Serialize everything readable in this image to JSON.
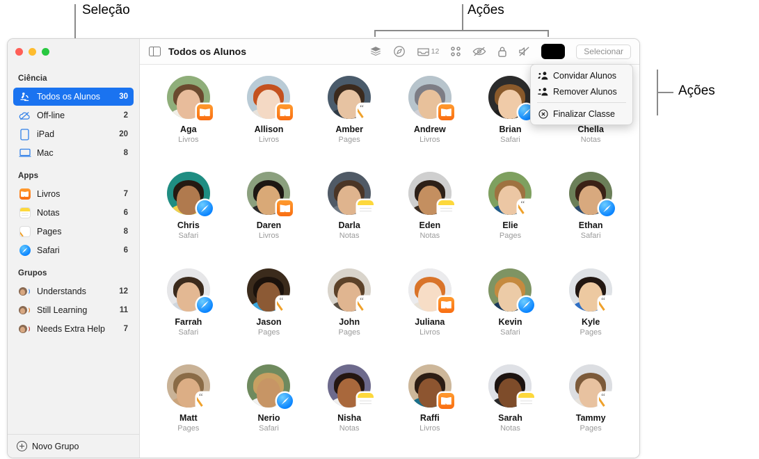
{
  "annotations": [
    {
      "id": "selecao",
      "text": "Seleção"
    },
    {
      "id": "acoes_top",
      "text": "Ações"
    },
    {
      "id": "acoes_right",
      "text": "Ações"
    }
  ],
  "window": {
    "traffic_lights": [
      "close",
      "minimize",
      "zoom"
    ]
  },
  "sidebar": {
    "sections": [
      {
        "header": "Ciência",
        "items": [
          {
            "label": "Todos os Alunos",
            "count": "30",
            "icon": "microscope-icon",
            "selected": true
          },
          {
            "label": "Off-line",
            "count": "2",
            "icon": "cloud-slash-icon",
            "selected": false
          },
          {
            "label": "iPad",
            "count": "20",
            "icon": "ipad-icon",
            "selected": false
          },
          {
            "label": "Mac",
            "count": "8",
            "icon": "mac-icon",
            "selected": false
          }
        ]
      },
      {
        "header": "Apps",
        "items": [
          {
            "label": "Livros",
            "count": "7",
            "icon": "books-app-icon",
            "selected": false
          },
          {
            "label": "Notas",
            "count": "6",
            "icon": "notes-app-icon",
            "selected": false
          },
          {
            "label": "Pages",
            "count": "8",
            "icon": "pages-app-icon",
            "selected": false
          },
          {
            "label": "Safari",
            "count": "6",
            "icon": "safari-app-icon",
            "selected": false
          }
        ]
      },
      {
        "header": "Grupos",
        "items": [
          {
            "label": "Understands",
            "count": "12",
            "icon": "group-blue-icon",
            "selected": false
          },
          {
            "label": "Still Learning",
            "count": "11",
            "icon": "group-orange-icon",
            "selected": false
          },
          {
            "label": "Needs Extra Help",
            "count": "7",
            "icon": "group-red-icon",
            "selected": false
          }
        ]
      }
    ],
    "footer": {
      "label": "Novo Grupo",
      "icon": "plus-circle-icon"
    }
  },
  "toolbar": {
    "sidebar_toggle_icon": "sidebar-toggle-icon",
    "title": "Todos os Alunos",
    "icons": [
      {
        "name": "layers-icon",
        "badge": ""
      },
      {
        "name": "navigate-icon",
        "badge": ""
      },
      {
        "name": "tray-icon",
        "badge": "12"
      },
      {
        "name": "grid-apps-icon",
        "badge": ""
      },
      {
        "name": "eye-slash-icon",
        "badge": ""
      },
      {
        "name": "lock-icon",
        "badge": ""
      },
      {
        "name": "mute-icon",
        "badge": ""
      }
    ],
    "screen_swatch_color": "#000000",
    "select_button": "Selecionar"
  },
  "menu": {
    "items": [
      {
        "label": "Convidar Alunos",
        "icon": "person-add-icon"
      },
      {
        "label": "Remover Alunos",
        "icon": "person-remove-icon"
      },
      {
        "label": "Finalizar Classe",
        "icon": "xmark-circle-icon"
      }
    ],
    "separator_after_index": 1
  },
  "students": [
    {
      "name": "Aga",
      "app": "Livros",
      "badge": "livros",
      "skin": "#e8bc9b",
      "hair": "#6b4a2f",
      "bg": "#8fae7a",
      "body": "#f2efe8"
    },
    {
      "name": "Allison",
      "app": "Livros",
      "badge": "livros",
      "skin": "#f4d9c4",
      "hair": "#c4521f",
      "bg": "#b9cbd6",
      "body": "#e8e3dc"
    },
    {
      "name": "Amber",
      "app": "Pages",
      "badge": "pages",
      "skin": "#e7c3a2",
      "hair": "#3b2a1d",
      "bg": "#4a5b6b",
      "body": "#2f3b46"
    },
    {
      "name": "Andrew",
      "app": "Livros",
      "badge": "livros",
      "skin": "#e8c19b",
      "hair": "#7d7d85",
      "bg": "#b7c4cc",
      "body": "#cfcfd4"
    },
    {
      "name": "Brian",
      "app": "Safari",
      "badge": "safari",
      "skin": "#f0cba8",
      "hair": "#8a5a2b",
      "bg": "#2b2b2b",
      "body": "#1e1e1e"
    },
    {
      "name": "Chella",
      "app": "Notas",
      "badge": "notas",
      "skin": "#d6a179",
      "hair": "#3a2418",
      "bg": "#c9d4dc",
      "body": "#5c86ad"
    },
    {
      "name": "Chris",
      "app": "Safari",
      "badge": "safari",
      "skin": "#b07a4e",
      "hair": "#241a12",
      "bg": "#1f8d82",
      "body": "#f3d14b"
    },
    {
      "name": "Daren",
      "app": "Livros",
      "badge": "livros",
      "skin": "#d9a977",
      "hair": "#1d1713",
      "bg": "#8ba07e",
      "body": "#2a2a2a"
    },
    {
      "name": "Darla",
      "app": "Notas",
      "badge": "notas",
      "skin": "#dfb48e",
      "hair": "#4a3526",
      "bg": "#505a66",
      "body": "#6d7782"
    },
    {
      "name": "Eden",
      "app": "Notas",
      "badge": "notas",
      "skin": "#c48f60",
      "hair": "#2d2018",
      "bg": "#cfcfcf",
      "body": "#3a2c22"
    },
    {
      "name": "Elie",
      "app": "Pages",
      "badge": "pages",
      "skin": "#ecc7a4",
      "hair": "#9e7240",
      "bg": "#7ea05f",
      "body": "#1f5a8a"
    },
    {
      "name": "Ethan",
      "app": "Safari",
      "badge": "safari",
      "skin": "#d8a97e",
      "hair": "#3a2116",
      "bg": "#6b7f58",
      "body": "#2a4a6e"
    },
    {
      "name": "Farrah",
      "app": "Safari",
      "badge": "safari",
      "skin": "#e3b893",
      "hair": "#3b2a1c",
      "bg": "#e6e6e8",
      "body": "#cfd6dd"
    },
    {
      "name": "Jason",
      "app": "Pages",
      "badge": "pages",
      "skin": "#8c5a35",
      "hair": "#1b120c",
      "bg": "#3b2b1c",
      "body": "#3aa7df"
    },
    {
      "name": "John",
      "app": "Pages",
      "badge": "pages",
      "skin": "#e0b590",
      "hair": "#5c4229",
      "bg": "#d9d4cb",
      "body": "#5a5044"
    },
    {
      "name": "Juliana",
      "app": "Livros",
      "badge": "livros",
      "skin": "#f7ddc6",
      "hair": "#d9742a",
      "bg": "#ebebed",
      "body": "#e8e2d8"
    },
    {
      "name": "Kevin",
      "app": "Safari",
      "badge": "safari",
      "skin": "#eccba7",
      "hair": "#c58a3f",
      "bg": "#7e9463",
      "body": "#1c3a5c"
    },
    {
      "name": "Kyle",
      "app": "Pages",
      "badge": "pages",
      "skin": "#edc9a1",
      "hair": "#221712",
      "bg": "#dfe2e6",
      "body": "#2f6fc4"
    },
    {
      "name": "Matt",
      "app": "Pages",
      "badge": "pages",
      "skin": "#dcae85",
      "hair": "#8a6b46",
      "bg": "#c9b296",
      "body": "#caa47b"
    },
    {
      "name": "Nerio",
      "app": "Safari",
      "badge": "safari",
      "skin": "#c79565",
      "hair": "#c8a062",
      "bg": "#6f8a5e",
      "body": "#f2f2f2"
    },
    {
      "name": "Nisha",
      "app": "Notas",
      "badge": "notas",
      "skin": "#a9683c",
      "hair": "#241611",
      "bg": "#6d6a8c",
      "body": "#efefef"
    },
    {
      "name": "Raffi",
      "app": "Livros",
      "badge": "livros",
      "skin": "#8d5530",
      "hair": "#2c1d14",
      "bg": "#cdb79a",
      "body": "#1b6f8a"
    },
    {
      "name": "Sarah",
      "app": "Notas",
      "badge": "notas",
      "skin": "#7e4c2a",
      "hair": "#1c1310",
      "bg": "#dfe1e6",
      "body": "#2a2a2a"
    },
    {
      "name": "Tammy",
      "app": "Pages",
      "badge": "pages",
      "skin": "#e8c2a0",
      "hair": "#7c5a3a",
      "bg": "#dcdee2",
      "body": "#e6e2dc"
    }
  ]
}
